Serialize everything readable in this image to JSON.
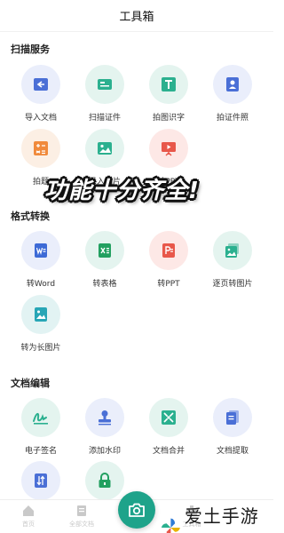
{
  "header": {
    "title": "工具箱"
  },
  "sections": [
    {
      "title": "扫描服务",
      "items": [
        {
          "label": "导入文档",
          "icon": "import-document-icon",
          "bg": "blue",
          "color": "#4a6fd6"
        },
        {
          "label": "扫描证件",
          "icon": "scan-id-icon",
          "bg": "green",
          "color": "#2bb08f"
        },
        {
          "label": "拍图识字",
          "icon": "text-recognition-icon",
          "bg": "green",
          "color": "#2bb08f"
        },
        {
          "label": "拍证件照",
          "icon": "id-photo-icon",
          "bg": "blue",
          "color": "#4a6fd6"
        },
        {
          "label": "拍题",
          "icon": "calculator-icon",
          "bg": "orange",
          "color": "#f08a3c"
        },
        {
          "label": "导入图片",
          "icon": "image-icon",
          "bg": "green",
          "color": "#2bb08f"
        },
        {
          "label": "拍PPT",
          "icon": "presentation-icon",
          "bg": "red",
          "color": "#e8574a"
        }
      ]
    },
    {
      "title": "格式转换",
      "items": [
        {
          "label": "转Word",
          "icon": "word-icon",
          "bg": "blue",
          "color": "#3d6ad6"
        },
        {
          "label": "转表格",
          "icon": "excel-icon",
          "bg": "green",
          "color": "#22a060"
        },
        {
          "label": "转PPT",
          "icon": "ppt-icon",
          "bg": "red",
          "color": "#e8574a"
        },
        {
          "label": "逐页转图片",
          "icon": "pages-to-image-icon",
          "bg": "green",
          "color": "#2bb08f"
        },
        {
          "label": "转为长图片",
          "icon": "long-image-icon",
          "bg": "teal",
          "color": "#27a6b6"
        }
      ]
    },
    {
      "title": "文档编辑",
      "items": [
        {
          "label": "电子签名",
          "icon": "signature-icon",
          "bg": "green",
          "color": "#2bb08f"
        },
        {
          "label": "添加水印",
          "icon": "stamp-icon",
          "bg": "blue",
          "color": "#4a6fd6"
        },
        {
          "label": "文档合并",
          "icon": "merge-icon",
          "bg": "green",
          "color": "#2bb08f"
        },
        {
          "label": "文档提取",
          "icon": "extract-icon",
          "bg": "blue",
          "color": "#4a6fd6"
        },
        {
          "label": "",
          "icon": "sort-icon",
          "bg": "blue",
          "color": "#4a6fd6"
        },
        {
          "label": "",
          "icon": "lock-icon",
          "bg": "green",
          "color": "#22a060"
        }
      ]
    }
  ],
  "overlay": {
    "text": "功能十分齐全!"
  },
  "bottom_nav": [
    {
      "label": "首页",
      "icon": "home-icon"
    },
    {
      "label": "全部文档",
      "icon": "documents-icon"
    },
    {
      "label": "工具箱",
      "icon": "toolbox-icon"
    }
  ],
  "fab": {
    "icon": "camera-icon",
    "color": "#1ea38a"
  },
  "watermark": {
    "text": "爱土手游网",
    "icon": "windmill-logo-icon"
  }
}
